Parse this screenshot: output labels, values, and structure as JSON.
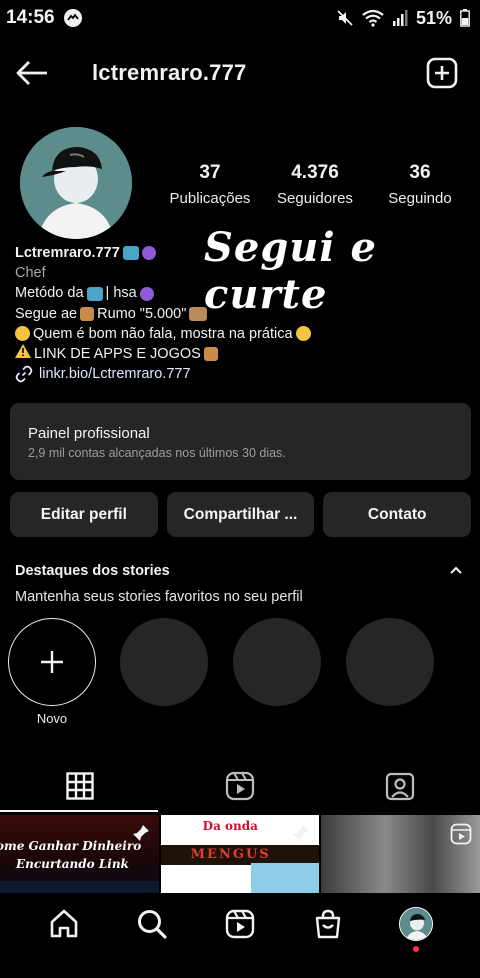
{
  "status_bar": {
    "time": "14:56",
    "battery": "51%"
  },
  "header": {
    "username": "lctremraro.777"
  },
  "stats": [
    {
      "value": "37",
      "label": "Publicações"
    },
    {
      "value": "4.376",
      "label": "Seguidores"
    },
    {
      "value": "36",
      "label": "Seguindo"
    }
  ],
  "overlay_text": "Segui e curte",
  "bio": {
    "name": "Lctremraro.777",
    "category": "Chef",
    "line1": "Metódo da",
    "line1b": "| hsa",
    "line2a": "Segue ae",
    "line2b": "Rumo \"5.000\"",
    "line3": "Quem é bom não fala, mostra na prática",
    "line4": "LINK DE APPS E JOGOS",
    "link": "linkr.bio/Lctremraro.777"
  },
  "panel": {
    "title": "Painel profissional",
    "subtitle": "2,9 mil contas alcançadas nos últimos 30 dias."
  },
  "actions": {
    "edit": "Editar perfil",
    "share": "Compartilhar ...",
    "contact": "Contato"
  },
  "stories": {
    "title": "Destaques dos stories",
    "subtitle": "Mantenha seus stories favoritos no seu perfil",
    "new_label": "Novo"
  },
  "grid_captions": {
    "cell1_line1": "ome Ganhar Dinheiro",
    "cell1_line2": "Encurtando Link",
    "cell2_top": "Da onda",
    "cell2_mid": "MENGUS"
  },
  "colors": {
    "background": "#000000",
    "button": "#262626",
    "muted": "#a8a8a8",
    "notification_dot": "#ff3040"
  },
  "icons": [
    "back-arrow-icon",
    "add-post-icon",
    "grid-icon",
    "reels-icon",
    "tagged-icon",
    "home-icon",
    "search-icon",
    "reels-nav-icon",
    "shop-icon",
    "profile-avatar"
  ]
}
